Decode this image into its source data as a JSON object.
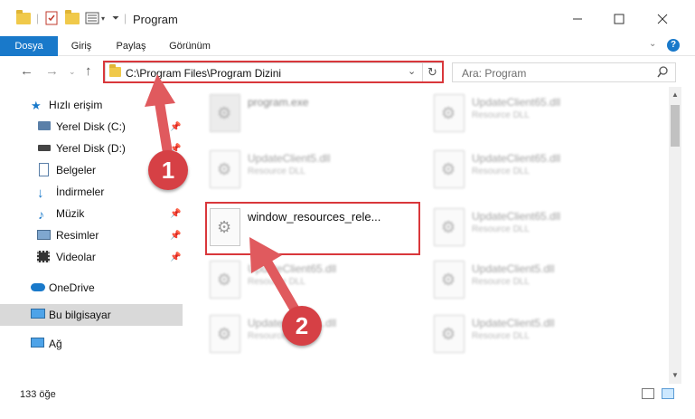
{
  "window": {
    "title": "Program"
  },
  "ribbon": {
    "tabs": [
      {
        "label": "Dosya"
      },
      {
        "label": "Giriş"
      },
      {
        "label": "Paylaş"
      },
      {
        "label": "Görünüm"
      }
    ]
  },
  "address": {
    "path": "C:\\Program Files\\Program Dizini"
  },
  "search": {
    "placeholder": "Ara: Program"
  },
  "sidebar": {
    "items": [
      {
        "label": "Hızlı erişim"
      },
      {
        "label": "Yerel Disk (C:)"
      },
      {
        "label": "Yerel Disk (D:)"
      },
      {
        "label": "Belgeler"
      },
      {
        "label": "İndirmeler"
      },
      {
        "label": "Müzik"
      },
      {
        "label": "Resimler"
      },
      {
        "label": "Videolar"
      },
      {
        "label": "OneDrive"
      },
      {
        "label": "Bu bilgisayar"
      },
      {
        "label": "Ağ"
      }
    ]
  },
  "files": [
    {
      "name": "program.exe",
      "type": ""
    },
    {
      "name": "UpdateClient65.dll",
      "type": "Resource DLL"
    },
    {
      "name": "UpdateClient5.dll",
      "type": "Resource DLL"
    },
    {
      "name": "UpdateClient65.dll",
      "type": "Resource DLL"
    },
    {
      "name": "window_resources_rele...",
      "type": ""
    },
    {
      "name": "UpdateClient65.dll",
      "type": "Resource DLL"
    },
    {
      "name": "UpdateClient65.dll",
      "type": "Resource DLL"
    },
    {
      "name": "UpdateClient5.dll",
      "type": "Resource DLL"
    },
    {
      "name": "UpdateClient21.dll",
      "type": "Resource DLL"
    },
    {
      "name": "UpdateClient5.dll",
      "type": "Resource DLL"
    }
  ],
  "status": {
    "count": "133 öğe"
  },
  "annotations": {
    "step1": "1",
    "step2": "2"
  },
  "colors": {
    "accent": "#1979ca",
    "highlight": "#d9373b",
    "arrow": "#e05a5e"
  }
}
